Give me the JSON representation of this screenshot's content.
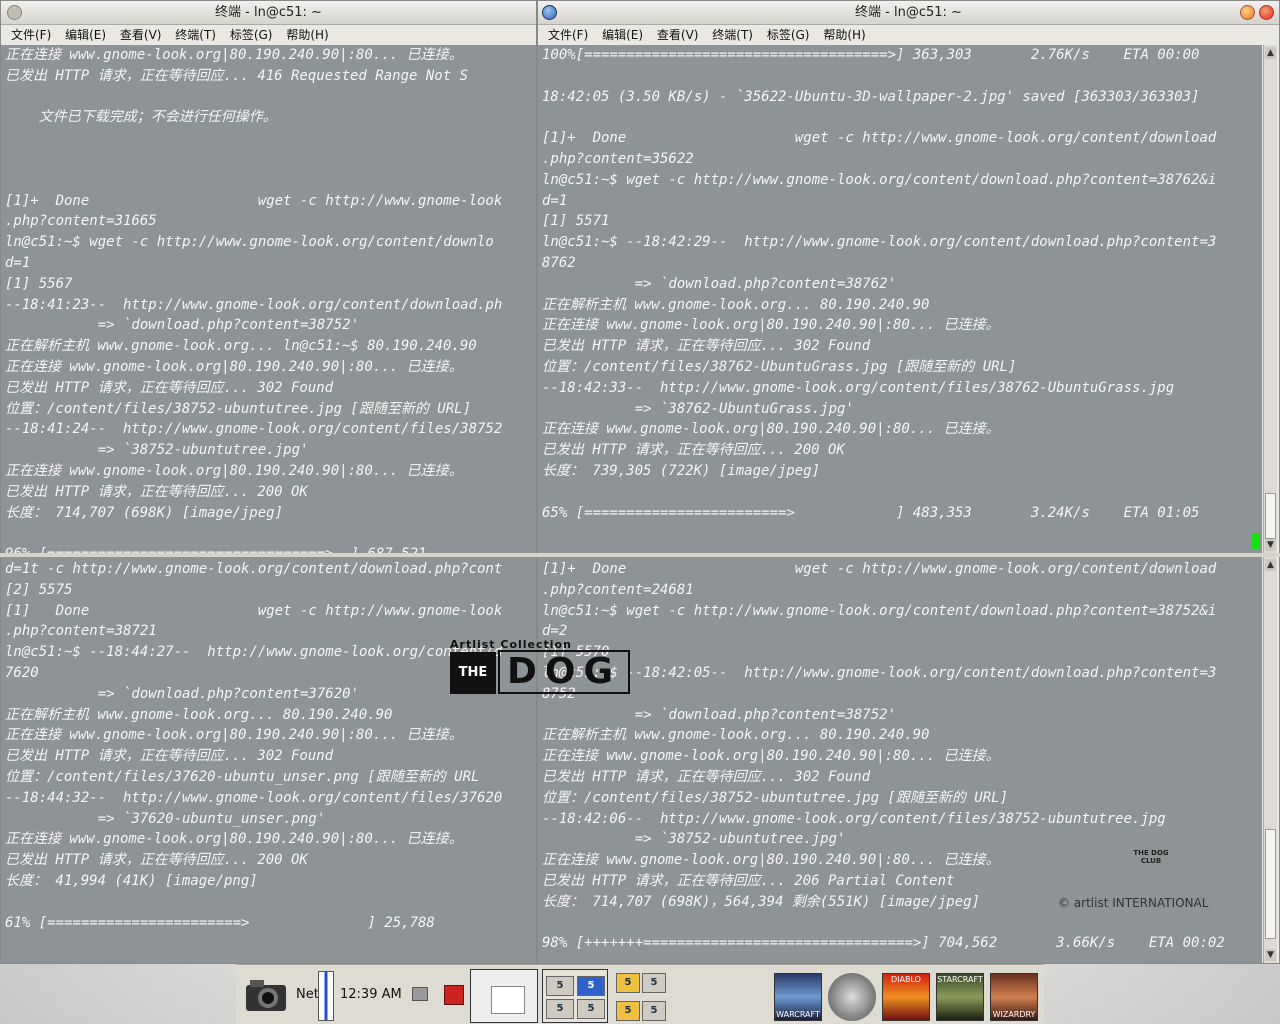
{
  "windows": [
    {
      "title": "终端 - ln@c51: ~",
      "menu": [
        "文件(F)",
        "编辑(E)",
        "查看(V)",
        "终端(T)",
        "标签(G)",
        "帮助(H)"
      ]
    },
    {
      "title": "终端 - ln@c51: ~",
      "menu": [
        "文件(F)",
        "编辑(E)",
        "查看(V)",
        "终端(T)",
        "标签(G)",
        "帮助(H)"
      ]
    }
  ],
  "panes": {
    "top_left": [
      "正在连接 www.gnome-look.org|80.190.240.90|:80... 已连接。",
      "已发出 HTTP 请求，正在等待回应... 416 Requested Range Not S",
      "",
      "    文件已下载完成；不会进行任何操作。",
      "",
      "",
      "",
      "[1]+  Done                    wget -c http://www.gnome-look",
      ".php?content=31665",
      "ln@c51:~$ wget -c http://www.gnome-look.org/content/downlo",
      "d=1",
      "[1] 5567",
      "--18:41:23--  http://www.gnome-look.org/content/download.ph",
      "           => `download.php?content=38752'",
      "正在解析主机 www.gnome-look.org... ln@c51:~$ 80.190.240.90",
      "正在连接 www.gnome-look.org|80.190.240.90|:80... 已连接。",
      "已发出 HTTP 请求，正在等待回应... 302 Found",
      "位置：/content/files/38752-ubuntutree.jpg [跟随至新的 URL]",
      "--18:41:24--  http://www.gnome-look.org/content/files/38752",
      "           => `38752-ubuntutree.jpg'",
      "正在连接 www.gnome-look.org|80.190.240.90|:80... 已连接。",
      "已发出 HTTP 请求，正在等待回应... 200 OK",
      "长度： 714,707 (698K) [image/jpeg]",
      "",
      "96% [=================================>  ] 687,521"
    ],
    "top_right": [
      "100%[====================================>] 363,303       2.76K/s    ETA 00:00",
      "",
      "18:42:05 (3.50 KB/s) - `35622-Ubuntu-3D-wallpaper-2.jpg' saved [363303/363303]",
      "",
      "[1]+  Done                    wget -c http://www.gnome-look.org/content/download",
      ".php?content=35622",
      "ln@c51:~$ wget -c http://www.gnome-look.org/content/download.php?content=38762&i",
      "d=1",
      "[1] 5571",
      "ln@c51:~$ --18:42:29--  http://www.gnome-look.org/content/download.php?content=3",
      "8762",
      "           => `download.php?content=38762'",
      "正在解析主机 www.gnome-look.org... 80.190.240.90",
      "正在连接 www.gnome-look.org|80.190.240.90|:80... 已连接。",
      "已发出 HTTP 请求，正在等待回应... 302 Found",
      "位置：/content/files/38762-UbuntuGrass.jpg [跟随至新的 URL]",
      "--18:42:33--  http://www.gnome-look.org/content/files/38762-UbuntuGrass.jpg",
      "           => `38762-UbuntuGrass.jpg'",
      "正在连接 www.gnome-look.org|80.190.240.90|:80... 已连接。",
      "已发出 HTTP 请求，正在等待回应... 200 OK",
      "长度： 739,305 (722K) [image/jpeg]",
      "",
      "65% [========================>            ] 483,353       3.24K/s    ETA 01:05"
    ],
    "bottom_left": [
      "d=1t -c http://www.gnome-look.org/content/download.php?cont",
      "[2] 5575",
      "[1]   Done                    wget -c http://www.gnome-look",
      ".php?content=38721",
      "ln@c51:~$ --18:44:27--  http://www.gnome-look.org/content/d",
      "7620",
      "           => `download.php?content=37620'",
      "正在解析主机 www.gnome-look.org... 80.190.240.90",
      "正在连接 www.gnome-look.org|80.190.240.90|:80... 已连接。",
      "已发出 HTTP 请求，正在等待回应... 302 Found",
      "位置：/content/files/37620-ubuntu_unser.png [跟随至新的 URL",
      "--18:44:32--  http://www.gnome-look.org/content/files/37620",
      "           => `37620-ubuntu_unser.png'",
      "正在连接 www.gnome-look.org|80.190.240.90|:80... 已连接。",
      "已发出 HTTP 请求，正在等待回应... 200 OK",
      "长度： 41,994 (41K) [image/png]",
      "",
      "61% [=======================>              ] 25,788"
    ],
    "bottom_right": [
      "[1]+  Done                    wget -c http://www.gnome-look.org/content/download",
      ".php?content=24681",
      "ln@c51:~$ wget -c http://www.gnome-look.org/content/download.php?content=38752&i",
      "d=2",
      "[1] 5570",
      "ln@c51:~$ --18:42:05--  http://www.gnome-look.org/content/download.php?content=3",
      "8752",
      "           => `download.php?content=38752'",
      "正在解析主机 www.gnome-look.org... 80.190.240.90",
      "正在连接 www.gnome-look.org|80.190.240.90|:80... 已连接。",
      "已发出 HTTP 请求，正在等待回应... 302 Found",
      "位置：/content/files/38752-ubuntutree.jpg [跟随至新的 URL]",
      "--18:42:06--  http://www.gnome-look.org/content/files/38752-ubuntutree.jpg",
      "           => `38752-ubuntutree.jpg'",
      "正在连接 www.gnome-look.org|80.190.240.90|:80... 已连接。",
      "已发出 HTTP 请求，正在等待回应... 206 Partial Content",
      "长度： 714,707 (698K)，564,394 剩余(551K) [image/jpeg]",
      "",
      "98% [+++++++================================>] 704,562       3.66K/s    ETA 00:02"
    ]
  },
  "wallpaper": {
    "collection": "Artlist Collection",
    "the": "THE",
    "dog": "DOG",
    "club_badge": "THE DOG CLUB",
    "copyright": "© artlist INTERNATIONAL"
  },
  "taskbar": {
    "net_label": "Net",
    "clock": "12:39 AM",
    "workspaces": [
      "5",
      "5",
      "5",
      "5",
      "5",
      "5",
      "5",
      "5"
    ],
    "games": [
      "WARCRAFT",
      "",
      "DIABLO",
      "STARCRAFT",
      "WIZARDRY"
    ]
  },
  "colors": {
    "pane_bg": "#7a8084",
    "text": "#f5f5f5",
    "progress_green": "#14e014",
    "workspace_active": "#2f62c8"
  }
}
